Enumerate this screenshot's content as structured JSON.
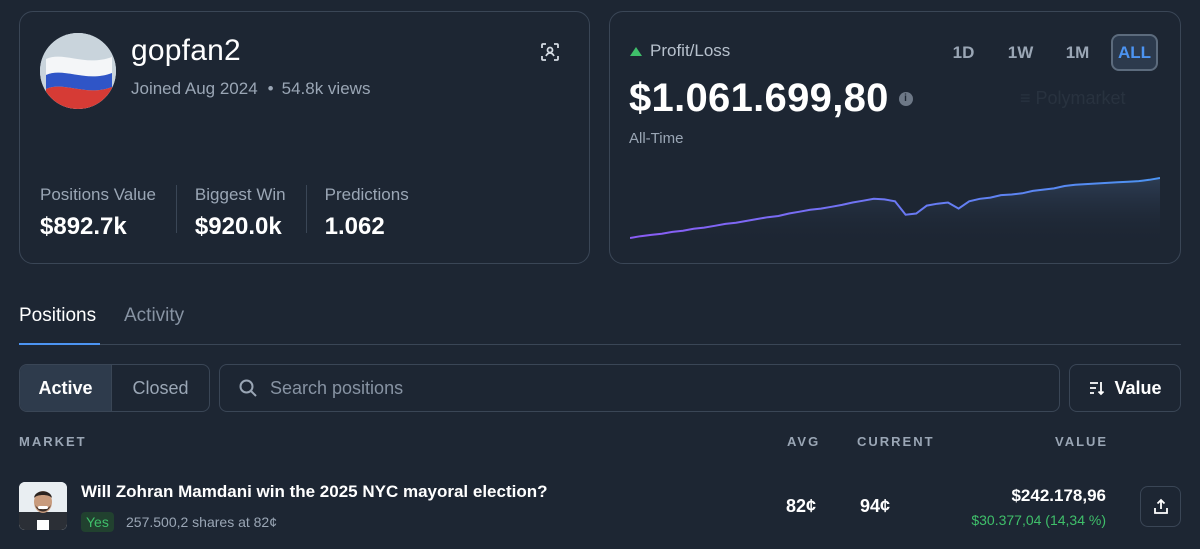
{
  "profile": {
    "username": "gopfan2",
    "joined": "Joined Aug 2024",
    "dot": "•",
    "views": "54.8k views",
    "stats": [
      {
        "label": "Positions Value",
        "value": "$892.7k"
      },
      {
        "label": "Biggest Win",
        "value": "$920.0k"
      },
      {
        "label": "Predictions",
        "value": "1.062"
      }
    ],
    "avatar_icon": "russian-flag-avatar",
    "scan_icon": "scan-icon"
  },
  "pnl": {
    "title": "Profit/Loss",
    "amount": "$1.061.699,80",
    "subtitle": "All-Time",
    "ghost_label": "≡ Polymarket",
    "ranges": [
      "1D",
      "1W",
      "1M",
      "ALL"
    ],
    "active_range": "ALL",
    "colors": {
      "up": "#3fbf6a",
      "line_start": "#8b5cf6",
      "line_end": "#4c94f2",
      "accent": "#4c94f2"
    }
  },
  "chart_data": {
    "type": "line",
    "x": [
      0,
      1,
      2,
      3,
      4,
      5,
      6,
      7,
      8,
      9,
      10,
      11,
      12,
      13,
      14,
      15,
      16,
      17,
      18,
      19,
      20,
      21,
      22,
      23,
      24,
      25,
      26,
      27,
      28,
      29,
      30,
      31,
      32,
      33,
      34,
      35,
      36,
      37,
      38,
      39,
      40,
      41,
      42,
      43,
      44,
      45,
      46,
      47,
      48,
      49,
      50
    ],
    "y": [
      0.02,
      0.05,
      0.07,
      0.09,
      0.12,
      0.14,
      0.17,
      0.19,
      0.22,
      0.25,
      0.27,
      0.3,
      0.33,
      0.36,
      0.38,
      0.42,
      0.45,
      0.48,
      0.5,
      0.53,
      0.56,
      0.6,
      0.63,
      0.66,
      0.65,
      0.62,
      0.4,
      0.42,
      0.55,
      0.58,
      0.6,
      0.5,
      0.62,
      0.66,
      0.68,
      0.72,
      0.73,
      0.75,
      0.79,
      0.81,
      0.83,
      0.87,
      0.89,
      0.9,
      0.91,
      0.92,
      0.93,
      0.94,
      0.95,
      0.97,
      1.0
    ],
    "title": "",
    "xlabel": "",
    "ylabel": "",
    "grid": false,
    "legend": "none"
  },
  "tabs": [
    {
      "label": "Positions",
      "active": true
    },
    {
      "label": "Activity",
      "active": false
    }
  ],
  "filters": {
    "active_label": "Active",
    "closed_label": "Closed",
    "search_placeholder": "Search positions",
    "sort_label": "Value"
  },
  "table": {
    "headers": {
      "market": "MARKET",
      "avg": "AVG",
      "current": "CURRENT",
      "value": "VALUE"
    },
    "rows": [
      {
        "title": "Will Zohran Mamdani win the 2025 NYC mayoral election?",
        "outcome": "Yes",
        "shares": "257.500,2 shares at 82¢",
        "avg": "82¢",
        "current": "94¢",
        "value": "$242.178,96",
        "change": "$30.377,04 (14,34 %)"
      }
    ]
  }
}
